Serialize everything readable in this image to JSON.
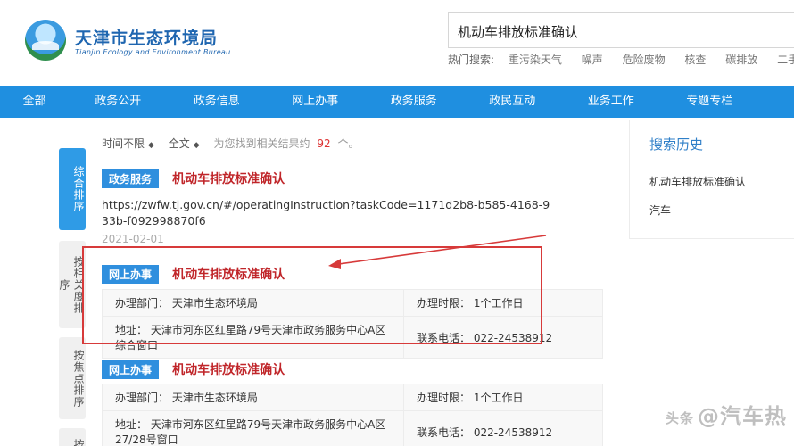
{
  "header": {
    "site_title": "天津市生态环境局",
    "site_subtitle": "Tianjin Ecology and Environment Bureau",
    "search_value": "机动车排放标准确认",
    "hot_label": "热门搜索:",
    "hot_keywords": [
      "重污染天气",
      "噪声",
      "危险废物",
      "核查",
      "碳排放",
      "二手车"
    ]
  },
  "nav": [
    "全部",
    "政务公开",
    "政务信息",
    "网上办事",
    "政务服务",
    "政民互动",
    "业务工作",
    "专题专栏"
  ],
  "sort_tabs": [
    "综合排序",
    "按相关度排序",
    "按焦点排序",
    "按"
  ],
  "filter": {
    "time": "时间不限",
    "scope": "全文",
    "note_prefix": "为您找到相关结果约",
    "count": "92",
    "note_suffix": "个。"
  },
  "results": [
    {
      "tag": "政务服务",
      "title": "机动车排放标准确认",
      "url": "https://zwfw.tj.gov.cn/#/operatingInstruction?taskCode=1171d2b8-b585-4168-933b-f092998870f6",
      "date": "2021-02-01"
    },
    {
      "tag": "网上办事",
      "title": "机动车排放标准确认",
      "dept": "办理部门：  天津市生态环境局",
      "limit": "办理时限：  1个工作日",
      "address": "地址：  天津市河东区红星路79号天津市政务服务中心A区综合窗口",
      "phone": "联系电话：  022-24538912"
    },
    {
      "tag": "网上办事",
      "title": "机动车排放标准确认",
      "dept": "办理部门：  天津市生态环境局",
      "limit": "办理时限：  1个工作日",
      "address": "地址：  天津市河东区红星路79号天津市政务服务中心A区27/28号窗口",
      "phone": "联系电话：  022-24538912"
    }
  ],
  "history": {
    "title": "搜索历史",
    "items": [
      "机动车排放标准确认",
      "汽车"
    ]
  },
  "watermark": {
    "prefix": "头条",
    "text": "@汽车热"
  },
  "colors": {
    "nav_bg": "#1f8fe0",
    "tag_bg": "#2f8fde",
    "title_red": "#c0262a",
    "highlight_red": "#d73a3a"
  }
}
